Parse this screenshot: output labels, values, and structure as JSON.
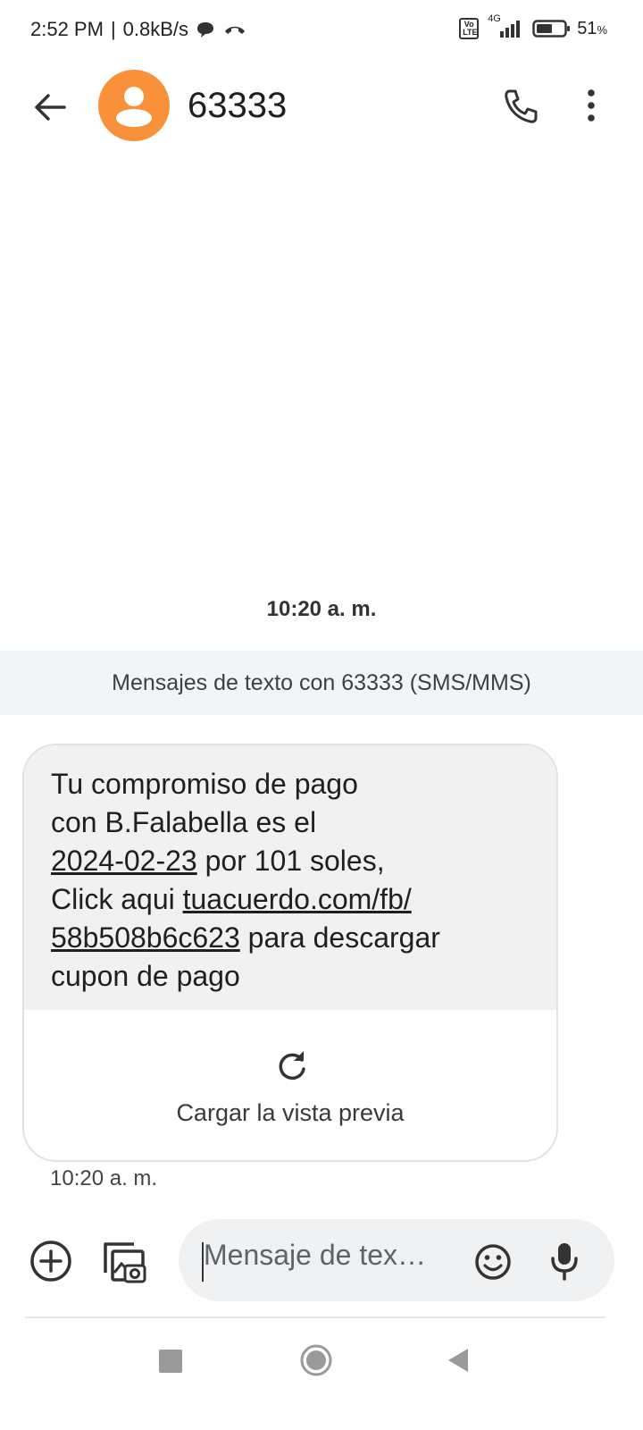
{
  "status_bar": {
    "time": "2:52 PM",
    "separator": "|",
    "speed": "0.8kB/s",
    "network": "4G",
    "volte": "Vo LTE",
    "battery": "51",
    "battery_unit": "%"
  },
  "header": {
    "contact_name": "63333",
    "avatar_color": "#f9903a"
  },
  "conversation": {
    "date_stamp": "10:20 a. m.",
    "info_banner": "Mensajes de texto con 63333 (SMS/MMS)",
    "message": {
      "line1": "Tu compromiso de pago",
      "line2": "con B.Falabella es el",
      "date_link": "2024-02-23",
      "line3_rest": " por 101 soles,",
      "line4_prefix": "Click aqui ",
      "url_part1": "tuacuerdo.com/fb/",
      "url_part2": "58b508b6c623",
      "line5_rest": " para descargar",
      "line6": "cupon de pago",
      "preview_label": "Cargar la vista previa",
      "time": "10:20 a. m."
    }
  },
  "compose": {
    "placeholder": "Mensaje de tex…"
  },
  "colors": {
    "accent": "#f9903a",
    "bubble_bg": "#f1f1f1",
    "banner_bg": "#f2f5f8"
  },
  "icons": [
    "back-arrow-icon",
    "person-icon",
    "phone-icon",
    "more-vert-icon",
    "refresh-icon",
    "add-circle-icon",
    "gallery-icon",
    "emoji-icon",
    "mic-icon",
    "nav-recents-icon",
    "nav-home-icon",
    "nav-back-icon"
  ]
}
